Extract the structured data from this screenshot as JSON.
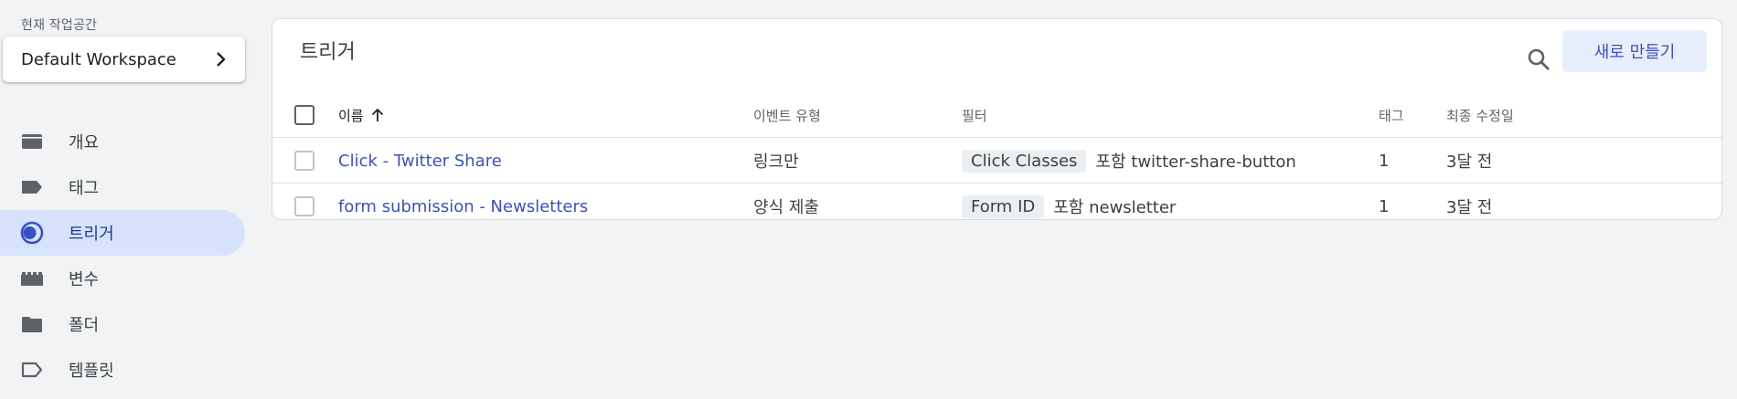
{
  "sidebar": {
    "workspace_label": "현재 작업공간",
    "workspace_name": "Default Workspace",
    "items": [
      {
        "label": "개요",
        "icon": "overview-icon"
      },
      {
        "label": "태그",
        "icon": "tag-icon"
      },
      {
        "label": "트리거",
        "icon": "trigger-icon",
        "active": true
      },
      {
        "label": "변수",
        "icon": "variable-icon"
      },
      {
        "label": "폴더",
        "icon": "folder-icon"
      },
      {
        "label": "템플릿",
        "icon": "template-icon"
      }
    ]
  },
  "main": {
    "title": "트리거",
    "new_button_label": "새로 만들기",
    "columns": {
      "name": "이름",
      "event_type": "이벤트 유형",
      "filter": "필터",
      "tags": "태그",
      "modified": "최종 수정일"
    },
    "rows": [
      {
        "name": "Click - Twitter Share",
        "event_type": "링크만",
        "filter_var": "Click Classes",
        "filter_op": "포함 twitter-share-button",
        "tags": "1",
        "modified": "3달 전"
      },
      {
        "name": "form submission - Newsletters",
        "event_type": "양식 제출",
        "filter_var": "Form ID",
        "filter_op": "포함 newsletter",
        "tags": "1",
        "modified": "3달 전"
      }
    ]
  },
  "colors": {
    "accent": "#3f51b5",
    "active_nav_bg": "#d7e3fb",
    "new_button_bg": "#e8eefb",
    "page_bg": "#f1f3f4"
  }
}
